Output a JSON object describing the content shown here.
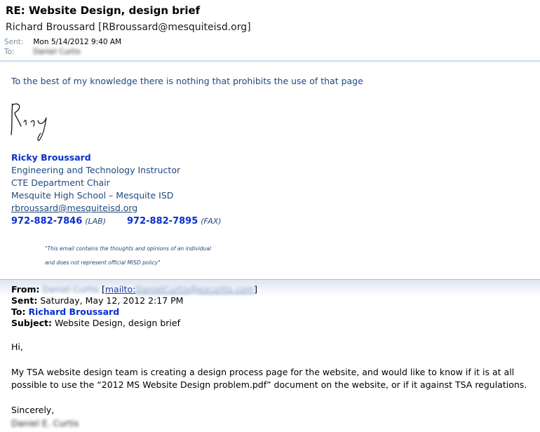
{
  "header": {
    "subject": "RE: Website Design, design brief",
    "from": "Richard Broussard [RBroussard@mesquiteisd.org]",
    "sent_label": "Sent:",
    "sent_value": "Mon 5/14/2012 9:40 AM",
    "to_label": "To:",
    "to_value": "Daniel Curtis"
  },
  "reply": {
    "text": "To the best of my knowledge there is nothing that prohibits the use of that page"
  },
  "signature": {
    "name": "Ricky Broussard",
    "title1": "Engineering and Technology Instructor",
    "title2": "CTE Department Chair",
    "title3": "Mesquite High School – Mesquite ISD",
    "email": "rbroussard@mesquiteisd.org",
    "phone_lab": "972-882-7846",
    "phone_lab_label": "(LAB)",
    "phone_fax": "972-882-7895",
    "phone_fax_label": "(FAX)",
    "handwritten": "Ricky",
    "disclaimer1": "\"This email contains the thoughts and opinions of an individual",
    "disclaimer2": "and does not represent official MISD policy\""
  },
  "forwarded": {
    "from_label": "From:",
    "from_name": "Daniel Curtis",
    "mailto_prefix": "mailto:",
    "mailto_address": "DanielCurtis@ezcurtis.com",
    "sent_label": "Sent:",
    "sent_value": "Saturday, May 12, 2012 2:17 PM",
    "to_label": "To:",
    "to_value": "Richard Broussard",
    "subject_label": "Subject:",
    "subject_value": "Website Design, design brief"
  },
  "body": {
    "greeting": "Hi,",
    "paragraph": "My TSA website design team is creating a design process page for the website, and would like to know if it is at all possible to use the “2012 MS Website Design problem.pdf” document on the website, or if it against TSA regulations.",
    "closing": "Sincerely,",
    "signer": "Daniel E. Curtis"
  }
}
